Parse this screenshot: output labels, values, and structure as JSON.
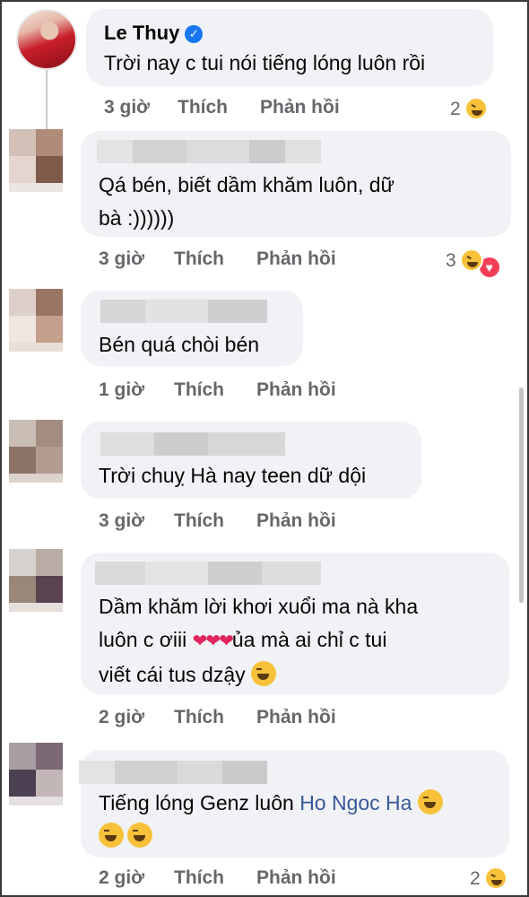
{
  "comments": [
    {
      "author": "Le Thuy",
      "verified": true,
      "text": "Trời nay c tui nói tiếng lóng luôn rồi",
      "time": "3 giờ",
      "like_label": "Thích",
      "reply_label": "Phản hồi",
      "reaction_count": "2"
    },
    {
      "text_line1": "Qá bén, biết dầm khăm luôn, dữ",
      "text_line2": "bà :))))))",
      "time": "3 giờ",
      "like_label": "Thích",
      "reply_label": "Phản hồi",
      "reaction_count": "3"
    },
    {
      "text": "Bén quá chòi bén",
      "time": "1 giờ",
      "like_label": "Thích",
      "reply_label": "Phản hồi"
    },
    {
      "text": "Trời chuỵ Hà nay teen dữ dội",
      "time": "3 giờ",
      "like_label": "Thích",
      "reply_label": "Phản hồi"
    },
    {
      "text_line1": "Dầm khăm lời khơi xuổi ma nà kha",
      "text_line2_a": "luôn c ơiii",
      "hearts": "❤❤❤",
      "text_line2_b": "ủa mà ai chỉ c tui",
      "text_line3": "viết cái tus dzậy",
      "time": "2 giờ",
      "like_label": "Thích",
      "reply_label": "Phản hồi"
    },
    {
      "text_line1_a": "Tiếng lóng Genz luôn",
      "mention": "Ho Ngoc Ha",
      "time": "2 giờ",
      "like_label": "Thích",
      "reply_label": "Phản hồi",
      "reaction_count": "2"
    }
  ],
  "icons": {
    "verified": "verified-check-icon",
    "laugh": "laugh-emoji-icon",
    "heart": "heart-reaction-icon"
  },
  "colors": {
    "bubble": "#f0f2f5",
    "meta": "#65676b",
    "verified": "#1877f2",
    "mention": "#385898"
  }
}
